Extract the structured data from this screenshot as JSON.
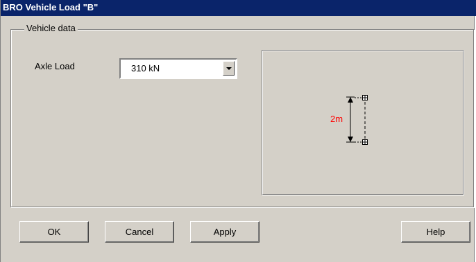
{
  "window": {
    "title": "BRO Vehicle Load \"B\""
  },
  "group": {
    "label": "Vehicle data"
  },
  "axle": {
    "label": "Axle Load",
    "value": "310 kN"
  },
  "preview": {
    "dimension_label": "2m"
  },
  "buttons": {
    "ok": "OK",
    "cancel": "Cancel",
    "apply": "Apply",
    "help": "Help"
  },
  "colors": {
    "titlebar": "#0a246a",
    "dialog": "#d4d0c8",
    "dimension": "#ff0000"
  }
}
